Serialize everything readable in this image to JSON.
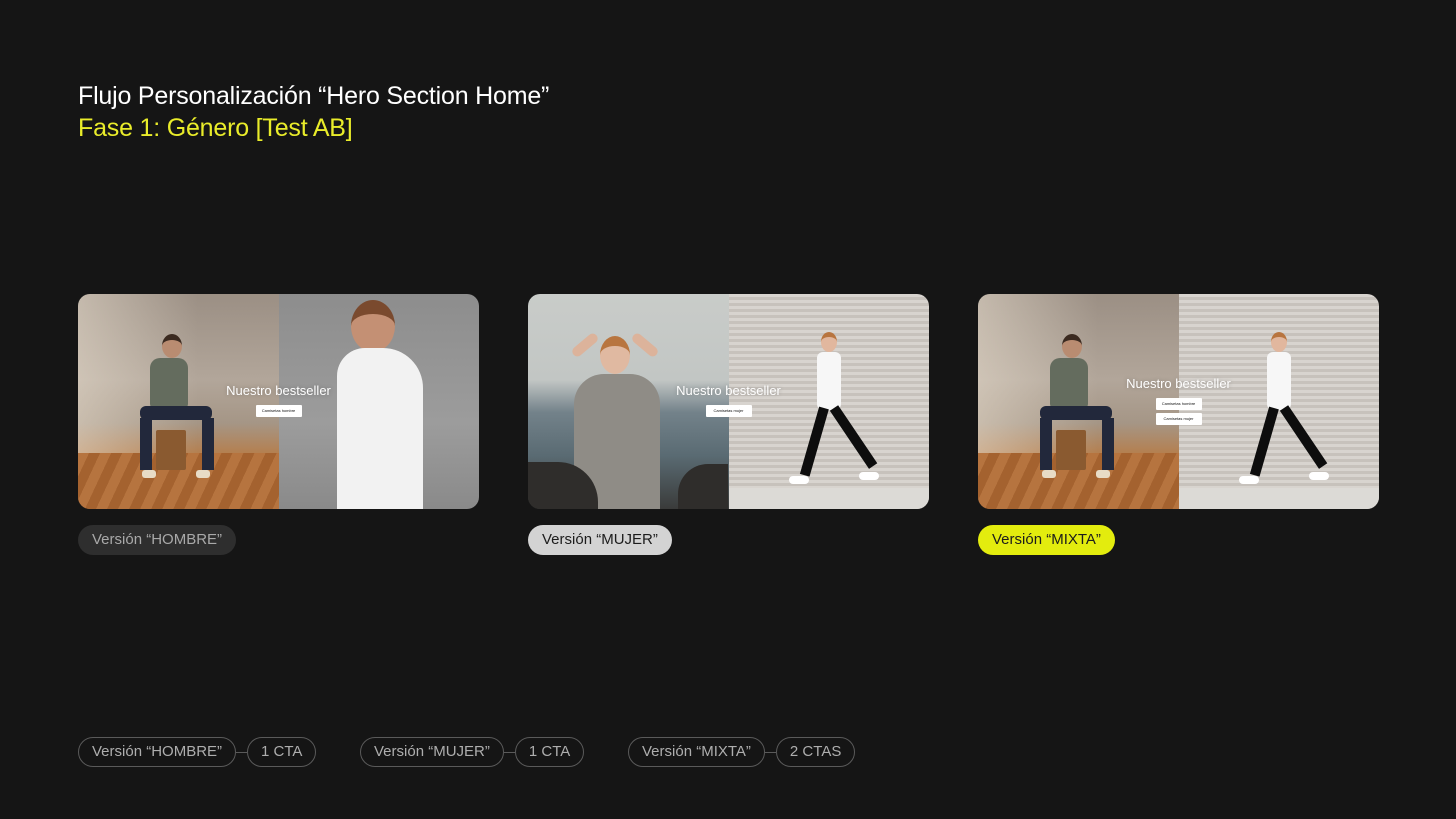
{
  "header": {
    "title": "Flujo Personalización “Hero Section Home”",
    "subtitle": "Fase 1: Género [Test AB]"
  },
  "cards": [
    {
      "hero_title": "Nuestro bestseller",
      "ctas": [
        "Camisetas hombre"
      ],
      "version_label": "Versión “HOMBRE”"
    },
    {
      "hero_title": "Nuestro bestseller",
      "ctas": [
        "Camisetas mujer"
      ],
      "version_label": "Versión “MUJER”"
    },
    {
      "hero_title": "Nuestro bestseller",
      "ctas": [
        "Camisetas hombre",
        "Camisetas mujer"
      ],
      "version_label": "Versión “MIXTA”"
    }
  ],
  "legend": [
    {
      "version": "Versión “HOMBRE”",
      "ctas": "1 CTA"
    },
    {
      "version": "Versión “MUJER”",
      "ctas": "1 CTA"
    },
    {
      "version": "Versión “MIXTA”",
      "ctas": "2 CTAS"
    }
  ],
  "colors": {
    "background": "#151515",
    "accent_yellow": "#e3ec0e",
    "subtitle_yellow": "#e9ec2a"
  }
}
